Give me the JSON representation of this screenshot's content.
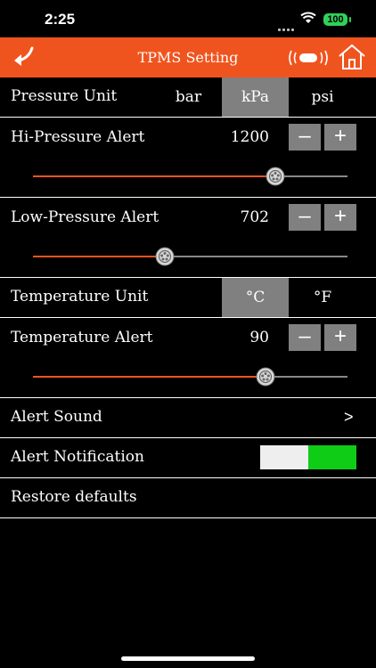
{
  "status_bar": {
    "time": "2:25",
    "battery": "100"
  },
  "nav": {
    "title": "TPMS Setting",
    "back_icon": "back-arrow-icon",
    "vibe_icon": "vibration-icon",
    "home_icon": "home-icon"
  },
  "pressure_unit": {
    "label": "Pressure Unit",
    "options": [
      "bar",
      "kPa",
      "psi"
    ],
    "selected": "kPa"
  },
  "hi_pressure": {
    "label": "Hi-Pressure Alert",
    "value": "1200",
    "minus": "–",
    "plus": "+",
    "slider_fraction": 0.77
  },
  "low_pressure": {
    "label": "Low-Pressure Alert",
    "value": "702",
    "minus": "–",
    "plus": "+",
    "slider_fraction": 0.42
  },
  "temp_unit": {
    "label": "Temperature Unit",
    "options": [
      "°C",
      "°F"
    ],
    "selected": "°C"
  },
  "temp_alert": {
    "label": "Temperature Alert",
    "value": "90",
    "minus": "–",
    "plus": "+",
    "slider_fraction": 0.74
  },
  "alert_sound": {
    "label": "Alert Sound",
    "chevron": ">"
  },
  "alert_notification": {
    "label": "Alert Notification",
    "enabled": true
  },
  "restore": {
    "label": "Restore defaults"
  },
  "colors": {
    "accent": "#f0541e",
    "toggle_on": "#0fcc17",
    "segment_active": "#808080"
  }
}
